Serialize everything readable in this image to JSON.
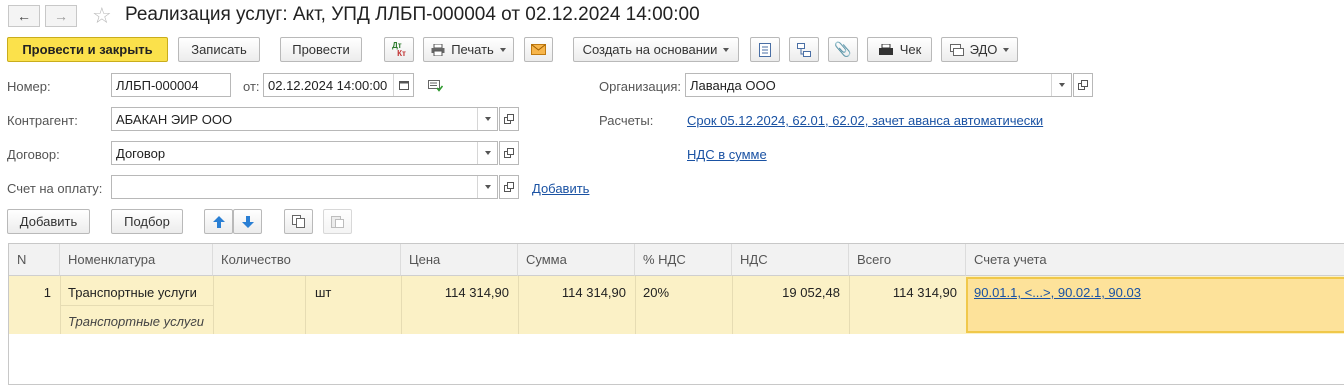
{
  "window": {
    "title": "Реализация услуг: Акт, УПД ЛЛБП-000004 от 02.12.2024 14:00:00"
  },
  "toolbar": {
    "post_and_close": "Провести и закрыть",
    "save": "Записать",
    "post": "Провести",
    "print": "Печать",
    "create_based_on": "Создать на основании",
    "check": "Чек",
    "edo": "ЭДО",
    "dt_kt_top": "Дт",
    "dt_kt_bottom": "Кт"
  },
  "form": {
    "number_label": "Номер:",
    "number_value": "ЛЛБП-000004",
    "date_label": "от:",
    "date_value": "02.12.2024 14:00:00",
    "organization_label": "Организация:",
    "organization_value": "Лаванда ООО",
    "counterparty_label": "Контрагент:",
    "counterparty_value": "АБАКАН ЭИР ООО",
    "settlements_label": "Расчеты:",
    "settlements_link": "Срок 05.12.2024, 62.01, 62.02, зачет аванса автоматически",
    "contract_label": "Договор:",
    "contract_value": "Договор",
    "vat_link": "НДС в сумме",
    "invoice_label": "Счет на оплату:",
    "invoice_value": "",
    "invoice_add_link": "Добавить"
  },
  "table_toolbar": {
    "add": "Добавить",
    "select": "Подбор"
  },
  "table": {
    "columns": [
      "N",
      "Номенклатура",
      "Количество",
      "Цена",
      "Сумма",
      "% НДС",
      "НДС",
      "Всего",
      "Счета учета"
    ],
    "rows": [
      {
        "n": "1",
        "item": "Транспортные услуги",
        "item_content": "Транспортные услуги",
        "quantity": "",
        "unit": "шт",
        "price": "114 314,90",
        "sum": "114 314,90",
        "vat_rate": "20%",
        "vat": "19 052,48",
        "total": "114 314,90",
        "accounts": "90.01.1, <...>, 90.02.1, 90.03"
      }
    ]
  },
  "colors": {
    "primary_button": "#fbe14b",
    "row_selected": "#fbf1c6",
    "link": "#1a52a3"
  }
}
